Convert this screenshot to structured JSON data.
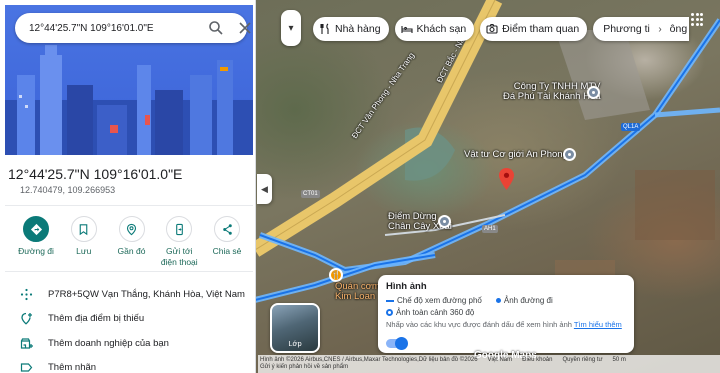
{
  "search": {
    "value": "12°44'25.7\"N 109°16'01.0\"E"
  },
  "place": {
    "title": "12°44'25.7\"N 109°16'01.0\"E",
    "decimal": "12.740479, 109.266953"
  },
  "actions": [
    {
      "label": "Đường đi",
      "icon": "directions-icon"
    },
    {
      "label": "Lưu",
      "icon": "bookmark-icon"
    },
    {
      "label": "Gần đó",
      "icon": "nearby-icon"
    },
    {
      "label": "Gửi tới điện thoại",
      "icon": "send-to-phone-icon"
    },
    {
      "label": "Chia sẻ",
      "icon": "share-icon"
    }
  ],
  "info": {
    "plus_code": "P7R8+5QW Vạn Thắng, Khánh Hòa, Việt Nam",
    "add_missing": "Thêm địa điểm bị thiếu",
    "add_business": "Thêm doanh nghiệp của bạn",
    "add_label": "Thêm nhãn"
  },
  "chips": [
    {
      "label": "Nhà hàng",
      "icon": "restaurant-icon"
    },
    {
      "label": "Khách sạn",
      "icon": "hotel-icon"
    },
    {
      "label": "Điểm tham quan",
      "icon": "camera-icon"
    },
    {
      "label": "Phương tiện công cộ",
      "icon": "transit-icon"
    }
  ],
  "map_labels": {
    "company": "Công Ty TNHH MTV Đá Phú Tài Khánh Hòa",
    "company_line1": "Công Ty TNHH MTV",
    "company_line2": "Đá Phú Tài Khánh Hòa",
    "vattu": "Vật tư Cơ giới An Phong",
    "diemdung_line1": "Điểm Dừng",
    "diemdung_line2": "Chân Cây Xoài",
    "quancom_line1": "Quán cơm Lầu",
    "quancom_line2": "Kim Loan",
    "dct_road": "ĐCT Vân Phong - Nha Trang",
    "dct_road2": "ĐCT Bắc - Nam",
    "shield_ql1a": "QL1A",
    "shield_ct01": "CT01",
    "shield_ah1": "AH1"
  },
  "layer": {
    "label": "Lớp"
  },
  "image_panel": {
    "title": "Hình ảnh",
    "street_view": "Chế độ xem đường phố",
    "street_line": "Ảnh đường đi",
    "photo_360": "Ảnh toàn cảnh 360 độ",
    "note": "Nhấp vào các khu vực được đánh dấu để xem hình ảnh",
    "learn_more": "Tìm hiểu thêm"
  },
  "attribution": {
    "imagery": "Hình ảnh ©2026 Airbus,CNES / Airbus,Maxar Technologies,Dữ liệu bản đồ ©2026",
    "country": "Việt Nam",
    "terms": "Điều khoản",
    "privacy": "Quyền riêng tư",
    "feedback": "Gửi ý kiến phản hồi về sản phẩm",
    "scale": "50 m",
    "watermark": "Google Maps"
  },
  "colors": {
    "accent": "#1a73e8",
    "teal": "#0b7a78",
    "hero": "#4a74e2"
  }
}
